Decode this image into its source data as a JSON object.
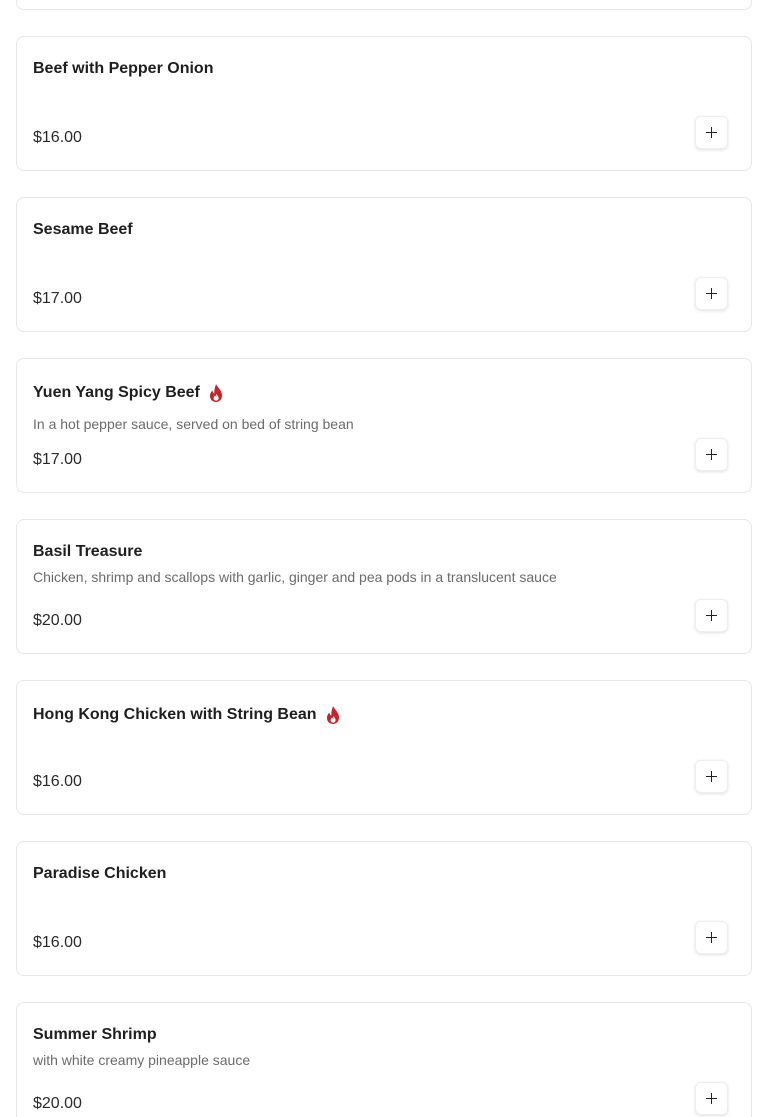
{
  "colors": {
    "spicy": "#c0262d",
    "card_border": "#e7e7e7",
    "description": "#6b6b6b"
  },
  "menu_items": [
    {
      "name": "Beef with Pepper Onion",
      "description": "",
      "price": "$16.00",
      "spicy": false
    },
    {
      "name": "Sesame Beef",
      "description": "",
      "price": "$17.00",
      "spicy": false
    },
    {
      "name": "Yuen Yang Spicy Beef",
      "description": "In a hot pepper sauce, served on bed of string bean",
      "price": "$17.00",
      "spicy": true
    },
    {
      "name": "Basil Treasure",
      "description": "Chicken, shrimp and scallops with garlic, ginger and pea pods in a translucent sauce",
      "price": "$20.00",
      "spicy": false
    },
    {
      "name": "Hong Kong Chicken with String Bean",
      "description": "",
      "price": "$16.00",
      "spicy": true
    },
    {
      "name": "Paradise Chicken",
      "description": "",
      "price": "$16.00",
      "spicy": false
    },
    {
      "name": "Summer Shrimp",
      "description": "with white creamy pineapple sauce",
      "price": "$20.00",
      "spicy": false
    }
  ]
}
